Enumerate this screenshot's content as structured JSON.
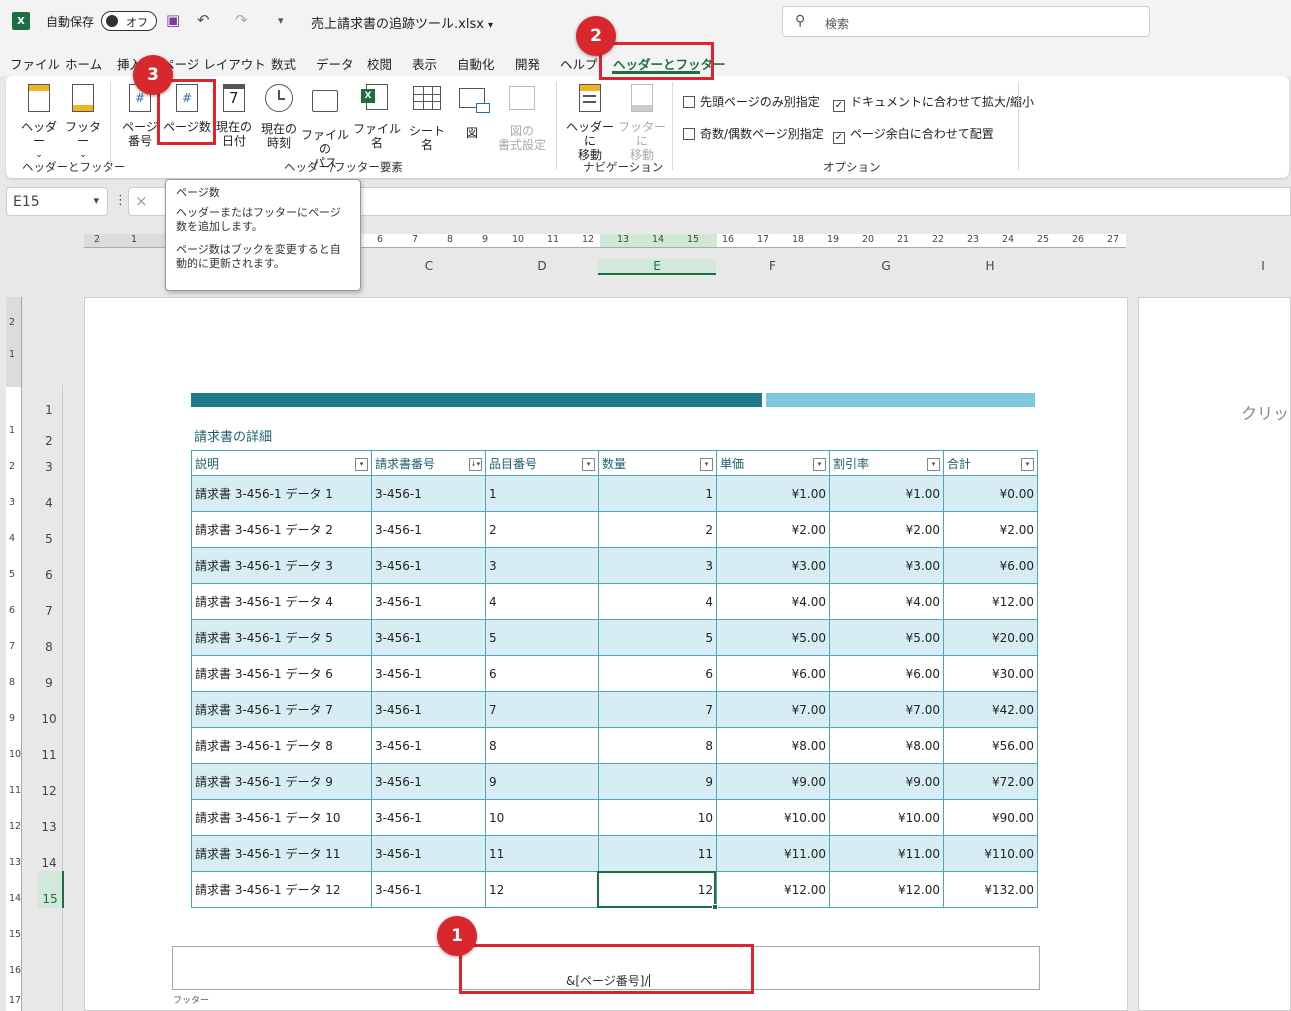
{
  "titlebar": {
    "logo": "X",
    "autosave_label": "自動保存",
    "autosave_state": "オフ",
    "filename": "売上請求書の追跡ツール.xlsx",
    "search_placeholder": "検索"
  },
  "menu": {
    "tabs": [
      "ファイル",
      "ホーム",
      "挿入",
      "ページ レイアウト",
      "数式",
      "データ",
      "校閲",
      "表示",
      "自動化",
      "開発",
      "ヘルプ",
      "ヘッダーとフッター"
    ]
  },
  "ribbon": {
    "header_btn": "ヘッダー",
    "footer_btn": "フッター",
    "group1_label": "ヘッダーとフッター",
    "page_number_btn": [
      "ページ",
      "番号"
    ],
    "page_count_btn": "ページ数",
    "current_date_btn": [
      "現在の",
      "日付"
    ],
    "current_time_btn": [
      "現在の",
      "時刻"
    ],
    "file_path_btn": [
      "ファイルの",
      "パス"
    ],
    "file_name_btn": "ファイル名",
    "sheet_name_btn": "シート名",
    "picture_btn": "図",
    "format_picture_btn": [
      "図の",
      "書式設定"
    ],
    "group2_label": "ヘッダー/フッター要素",
    "goto_header_btn": [
      "ヘッダーに",
      "移動"
    ],
    "goto_footer_btn": [
      "フッターに",
      "移動"
    ],
    "group3_label": "ナビゲーション",
    "opt_first_page": "先頭ページのみ別指定",
    "opt_odd_even": "奇数/偶数ページ別指定",
    "opt_scale": "ドキュメントに合わせて拡大/縮小",
    "opt_align": "ページ余白に合わせて配置",
    "opt_checks": [
      "☐",
      "☐",
      "☑",
      "☑"
    ],
    "group4_label": "オプション"
  },
  "formula": {
    "namebox": "E15",
    "cancel_icon": "×"
  },
  "tooltip": {
    "title": "ページ数",
    "line1": "ヘッダーまたはフッターにページ数を追加します。",
    "line2": "ページ数はブックを変更すると自動的に更新されます。"
  },
  "ruler": {
    "ticks": [
      "2",
      "1",
      "6",
      "7",
      "8",
      "9",
      "10",
      "11",
      "12",
      "13",
      "14",
      "15",
      "16",
      "17",
      "18",
      "19",
      "20",
      "21",
      "22",
      "23",
      "24",
      "25",
      "26",
      "27"
    ],
    "vticks": [
      "2",
      "1",
      "1",
      "2",
      "3",
      "4",
      "5",
      "6",
      "7",
      "8",
      "9",
      "10",
      "11",
      "12",
      "13",
      "14",
      "15",
      "16",
      "17"
    ]
  },
  "columns": [
    "C",
    "D",
    "E",
    "F",
    "G",
    "H",
    "I"
  ],
  "rows": [
    "1",
    "2",
    "3",
    "4",
    "5",
    "6",
    "7",
    "8",
    "9",
    "10",
    "11",
    "12",
    "13",
    "14",
    "15"
  ],
  "sheet": {
    "title": "請求書の詳細",
    "next_page_hint": "クリック",
    "headers": [
      "説明",
      "請求書番号",
      "品目番号",
      "数量",
      "単価",
      "割引率",
      "合計"
    ],
    "filter_icons": [
      "▾",
      "↓▾",
      "▾",
      "▾",
      "▾",
      "▾",
      "▾"
    ],
    "rows": [
      [
        "請求書 3-456-1 データ 1",
        "3-456-1",
        "1",
        "1",
        "¥1.00",
        "¥1.00",
        "¥0.00"
      ],
      [
        "請求書 3-456-1 データ 2",
        "3-456-1",
        "2",
        "2",
        "¥2.00",
        "¥2.00",
        "¥2.00"
      ],
      [
        "請求書 3-456-1 データ 3",
        "3-456-1",
        "3",
        "3",
        "¥3.00",
        "¥3.00",
        "¥6.00"
      ],
      [
        "請求書 3-456-1 データ 4",
        "3-456-1",
        "4",
        "4",
        "¥4.00",
        "¥4.00",
        "¥12.00"
      ],
      [
        "請求書 3-456-1 データ 5",
        "3-456-1",
        "5",
        "5",
        "¥5.00",
        "¥5.00",
        "¥20.00"
      ],
      [
        "請求書 3-456-1 データ 6",
        "3-456-1",
        "6",
        "6",
        "¥6.00",
        "¥6.00",
        "¥30.00"
      ],
      [
        "請求書 3-456-1 データ 7",
        "3-456-1",
        "7",
        "7",
        "¥7.00",
        "¥7.00",
        "¥42.00"
      ],
      [
        "請求書 3-456-1 データ 8",
        "3-456-1",
        "8",
        "8",
        "¥8.00",
        "¥8.00",
        "¥56.00"
      ],
      [
        "請求書 3-456-1 データ 9",
        "3-456-1",
        "9",
        "9",
        "¥9.00",
        "¥9.00",
        "¥72.00"
      ],
      [
        "請求書 3-456-1 データ 10",
        "3-456-1",
        "10",
        "10",
        "¥10.00",
        "¥10.00",
        "¥90.00"
      ],
      [
        "請求書 3-456-1 データ 11",
        "3-456-1",
        "11",
        "11",
        "¥11.00",
        "¥11.00",
        "¥110.00"
      ],
      [
        "請求書 3-456-1 データ 12",
        "3-456-1",
        "12",
        "12",
        "¥12.00",
        "¥12.00",
        "¥132.00"
      ]
    ]
  },
  "footer": {
    "content": "&[ページ番号]/",
    "label": "フッター"
  },
  "annotations": {
    "badge1": "1",
    "badge2": "2",
    "badge3": "3",
    "color": "#e0242d"
  },
  "colors": {
    "excel_green": "#1d6f42",
    "teal_dark": "#217a8a",
    "teal_light": "#7ec8de",
    "row_shade": "#d6edf3"
  }
}
